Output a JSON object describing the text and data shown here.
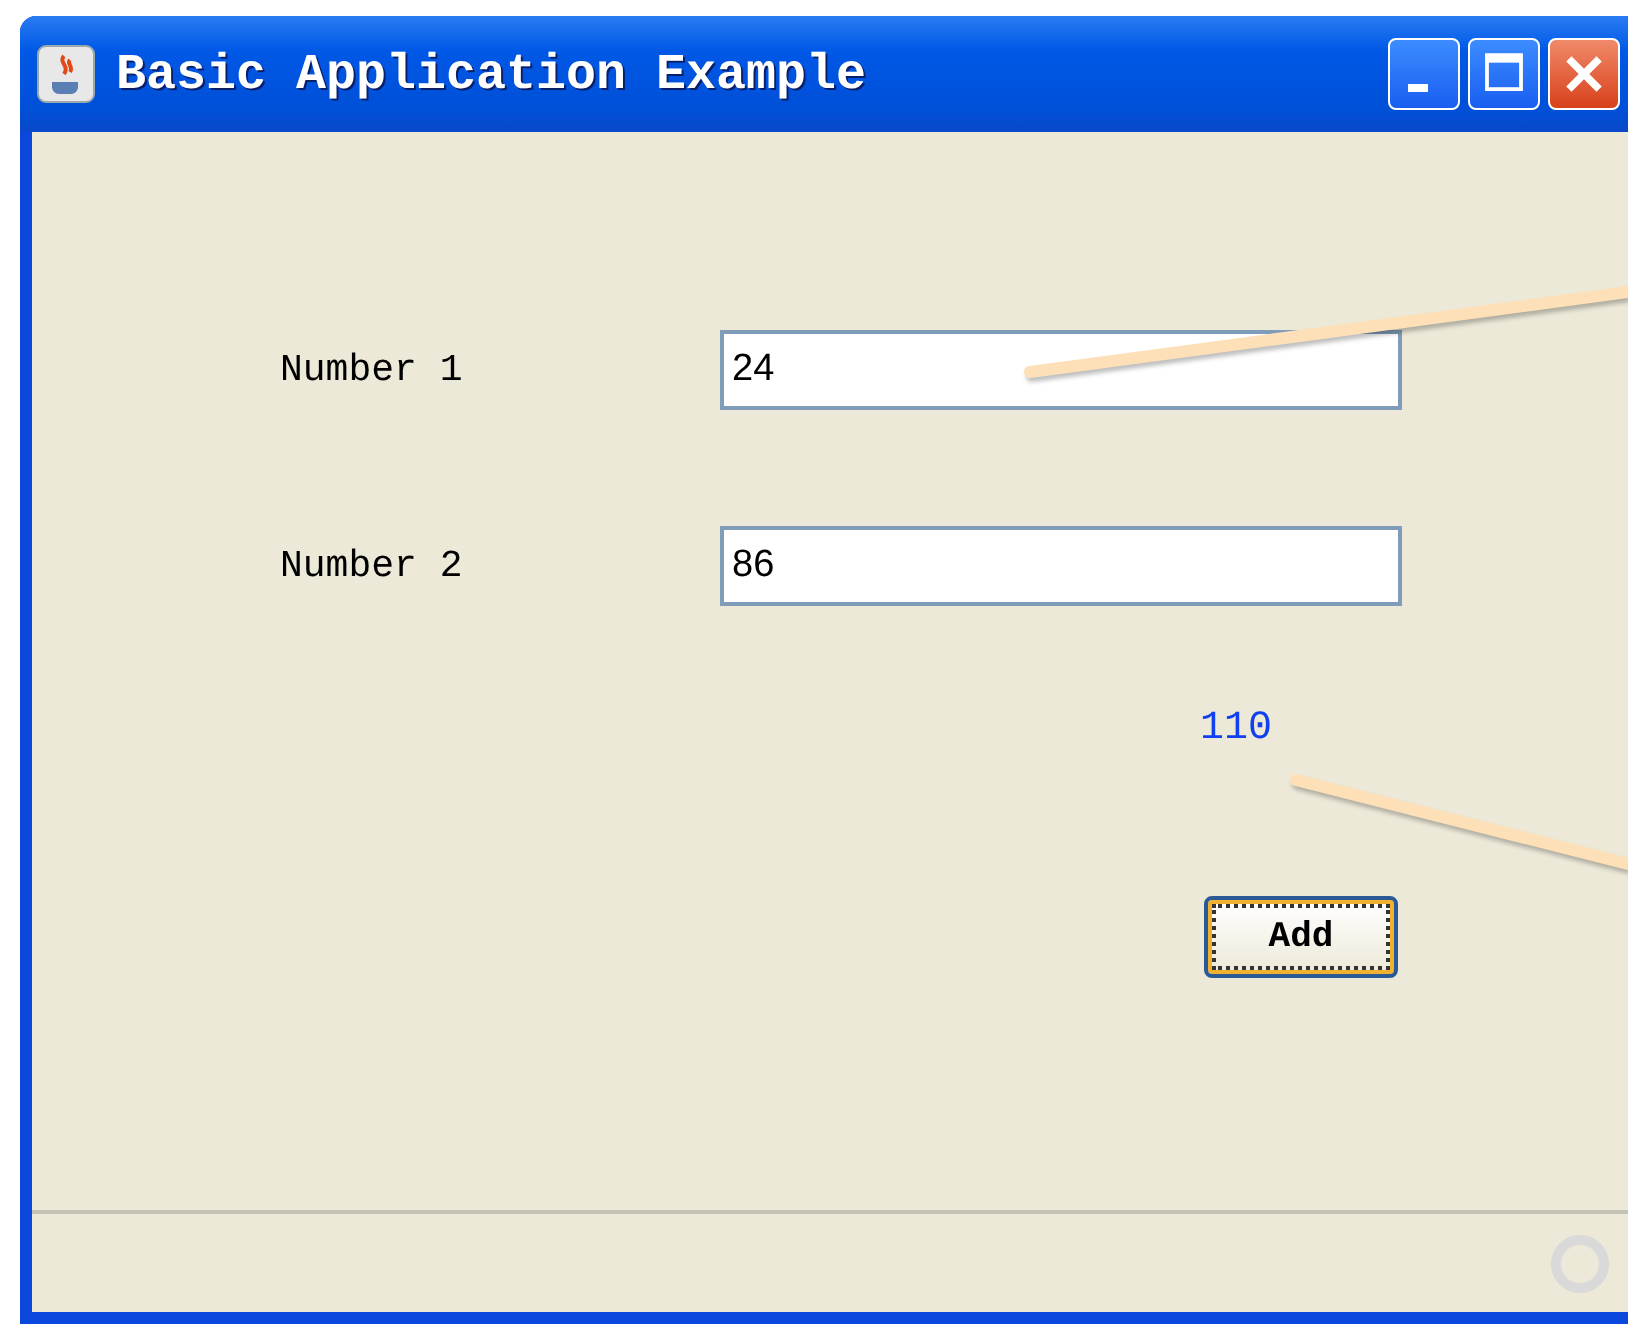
{
  "window": {
    "title": "Basic Application Example"
  },
  "fields": [
    {
      "label": "Number 1",
      "value": "24"
    },
    {
      "label": "Number 2",
      "value": "86"
    }
  ],
  "result": "110",
  "button": {
    "label": "Add",
    "focused": true
  }
}
